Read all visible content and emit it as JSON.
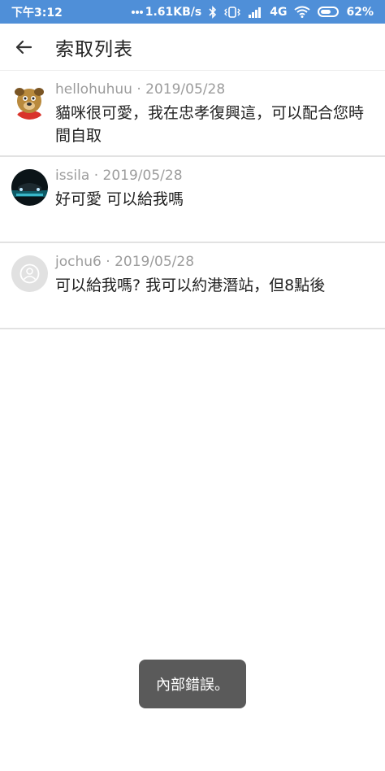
{
  "status_bar": {
    "time": "下午3:12",
    "network_speed": "1.61KB/s",
    "network_type": "4G",
    "battery": "62%",
    "battery_level": 0.62,
    "icons": [
      "more-dots-icon",
      "bluetooth-icon",
      "vibrate-icon",
      "signal-icon",
      "wifi-icon",
      "battery-icon"
    ]
  },
  "header": {
    "back_icon": "arrow-left-icon",
    "title": "索取列表"
  },
  "requests": [
    {
      "username": "hellohuhuu",
      "date": "2019/05/28",
      "message": "貓咪很可愛，我在忠孝復興這，可以配合您時間自取",
      "avatar": "dog-cartoon-avatar"
    },
    {
      "username": "issila",
      "date": "2019/05/28",
      "message": "好可愛 可以給我嗎",
      "avatar": "car-photo-avatar"
    },
    {
      "username": "jochu6",
      "date": "2019/05/28",
      "message": "可以給我嗎? 我可以約港潛站，但8點後",
      "avatar": "default-person-avatar"
    }
  ],
  "separator": "·",
  "toast": {
    "text": "內部錯誤。"
  },
  "colors": {
    "status_bar": "#4f8fd8",
    "meta_text": "#9c9c9c",
    "toast_bg": "#5a5a5a"
  }
}
